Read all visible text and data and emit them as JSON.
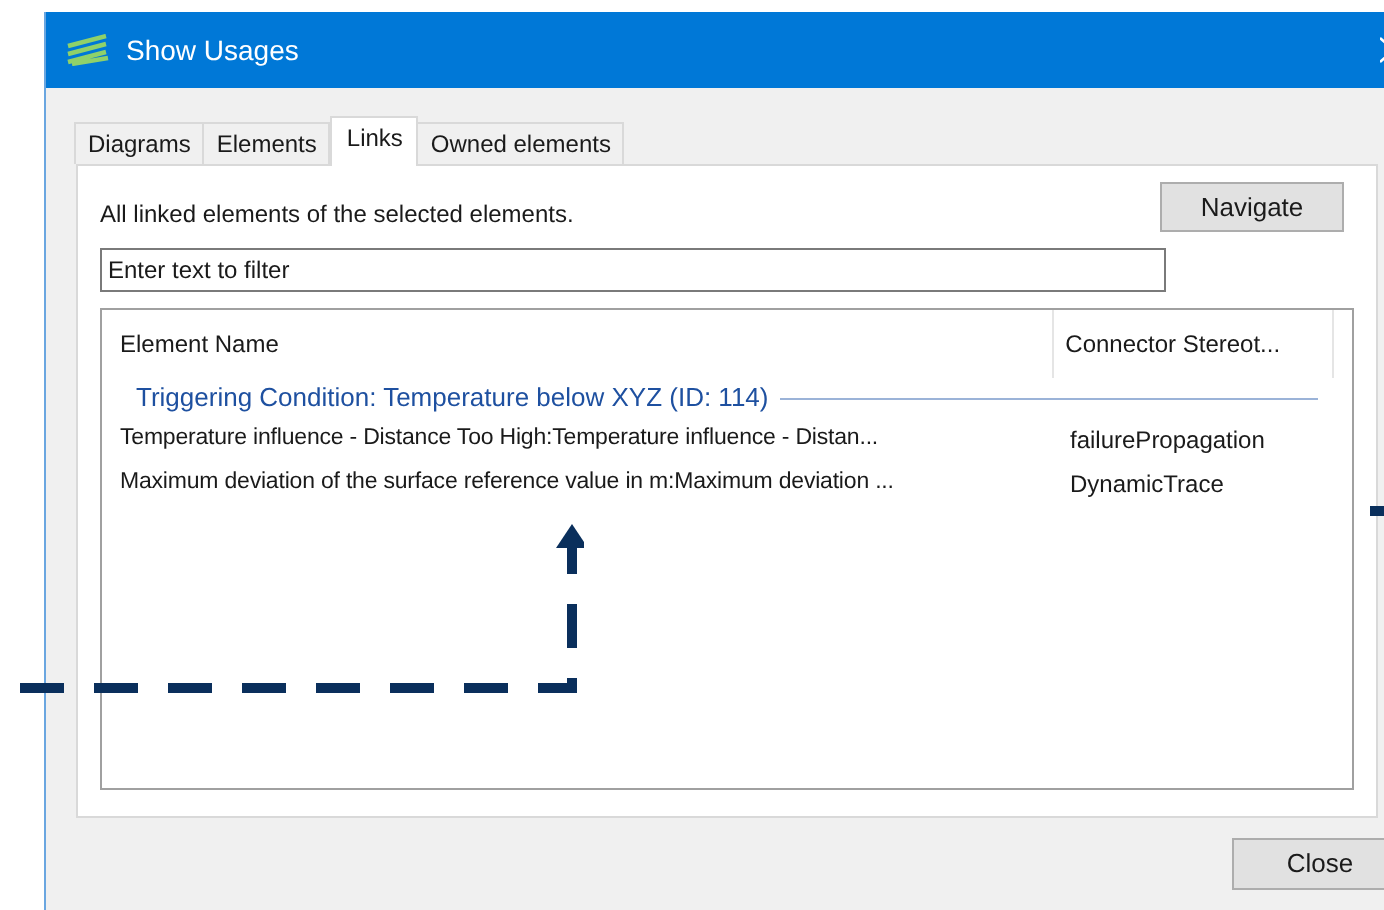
{
  "window": {
    "title": "Show Usages"
  },
  "tabs": [
    {
      "label": "Diagrams",
      "selected": false
    },
    {
      "label": "Elements",
      "selected": false
    },
    {
      "label": "Links",
      "selected": true
    },
    {
      "label": "Owned elements",
      "selected": false
    }
  ],
  "description": "All linked elements of the selected elements.",
  "navigate_button": "Navigate",
  "filter": {
    "placeholder": "Enter text to filter"
  },
  "list": {
    "columns": [
      "Element Name",
      "Connector Stereot..."
    ],
    "group": "Triggering Condition: Temperature below XYZ (ID: 114)",
    "rows": [
      {
        "name": "Temperature influence - Distance Too High:Temperature influence - Distan...",
        "stereotype": "failurePropagation"
      },
      {
        "name": "Maximum deviation of the surface reference value in m:Maximum deviation ...",
        "stereotype": "DynamicTrace"
      }
    ]
  },
  "close_button": "Close"
}
